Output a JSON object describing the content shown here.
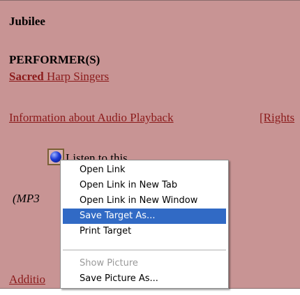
{
  "page": {
    "title": "Jubilee",
    "performers_heading": "PERFORMER(S)",
    "performer_name_bold": "Sacred",
    "performer_name_rest": " Harp Singers",
    "info_link": "Information about Audio Playback",
    "rights_link": "[Rights",
    "listen_text": "Listen to this",
    "mp3_text": "(MP3",
    "additional_link": "Additio"
  },
  "context_menu": {
    "items": [
      {
        "label": "Open Link"
      },
      {
        "label": "Open Link in New Tab"
      },
      {
        "label": "Open Link in New Window"
      },
      {
        "label": "Save Target As...",
        "selected": true
      },
      {
        "label": "Print Target"
      },
      {
        "label": "Show Picture",
        "disabled": true
      },
      {
        "label": "Save Picture As..."
      }
    ]
  },
  "colors": {
    "page_background": "#c89494",
    "link": "#8b1a1a",
    "menu_highlight": "#316ac5",
    "menu_disabled_text": "#9a9a9a"
  }
}
